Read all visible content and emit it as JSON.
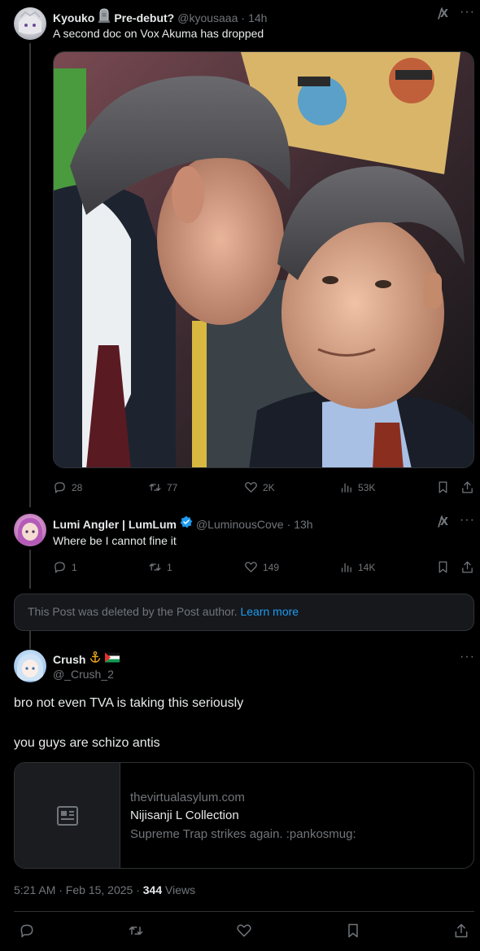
{
  "post1": {
    "name": "Kyouko",
    "name_suffix": "Pre-debut?",
    "handle": "@kyousaaa",
    "time": "14h",
    "text": "A second doc on Vox Akuma has dropped",
    "replies": "28",
    "reposts": "77",
    "likes": "2K",
    "views": "53K"
  },
  "post2": {
    "name": "Lumi Angler | LumLum",
    "handle": "@LuminousCove",
    "time": "13h",
    "text": "Where be I cannot fine it",
    "replies": "1",
    "reposts": "1",
    "likes": "149",
    "views": "14K"
  },
  "deleted_notice": {
    "text": "This Post was deleted by the Post author.",
    "link": "Learn more"
  },
  "main_post": {
    "name": "Crush",
    "handle": "@_Crush_2",
    "line1": "bro not even TVA is taking this seriously",
    "line2": "you guys are schizo antis",
    "card": {
      "domain": "thevirtualasylum.com",
      "title": "Nijisanji L Collection",
      "description": "Supreme Trap strikes again. :pankosmug:"
    },
    "timestamp": "5:21 AM · Feb 15, 2025 · ",
    "views_count": "344",
    "views_label": " Views"
  },
  "colors": {
    "background": "#000000",
    "text": "#e7e9ea",
    "muted": "#71767b",
    "link": "#1d9bf0",
    "verified": "#1d9bf0",
    "border": "#2f3336"
  }
}
